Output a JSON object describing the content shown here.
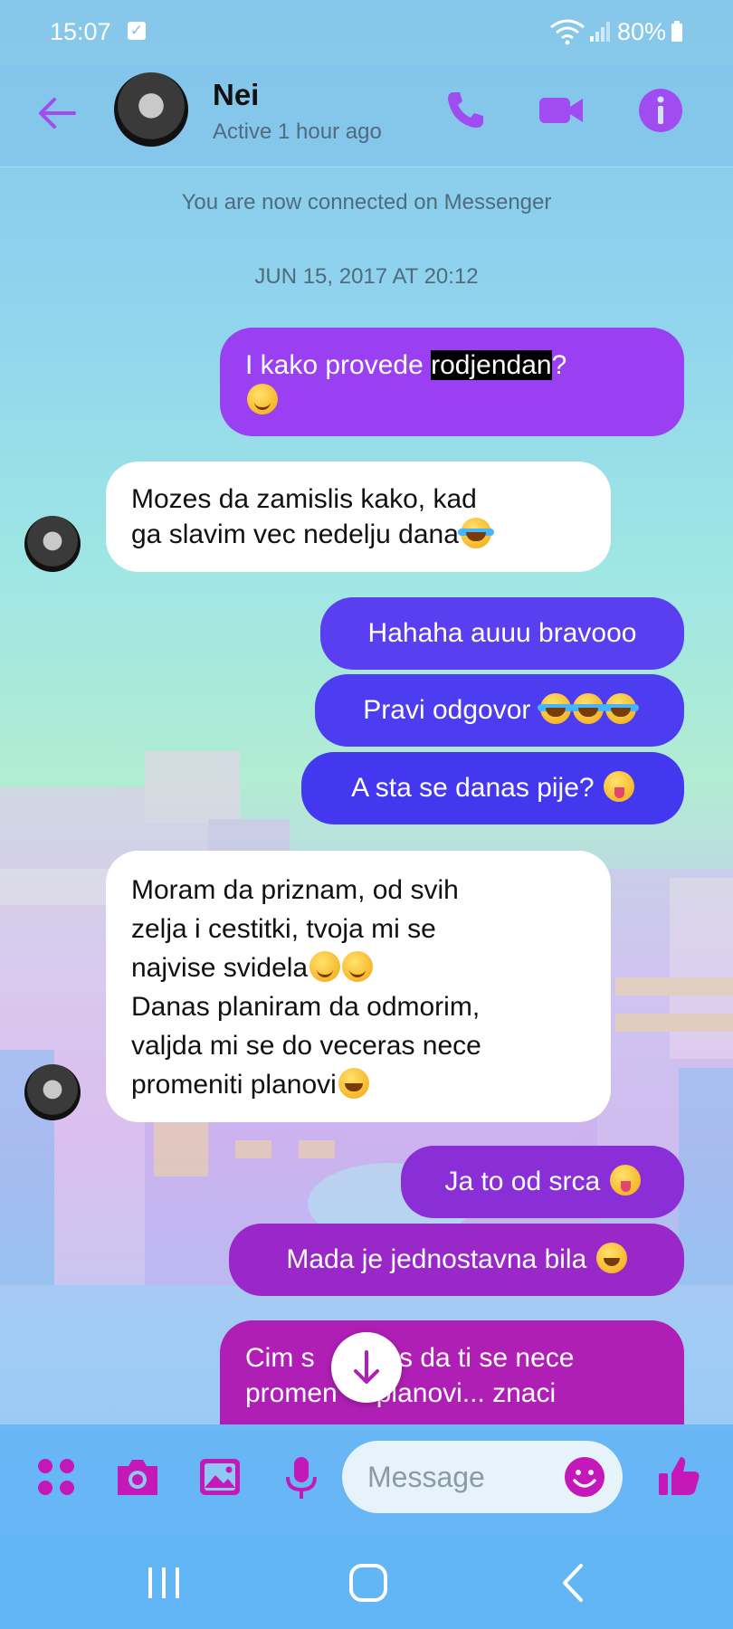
{
  "status_bar": {
    "time": "15:07",
    "battery": "80%"
  },
  "header": {
    "name": "Nei",
    "status": "Active 1 hour ago"
  },
  "chat": {
    "system_notice": "You are now connected on Messenger",
    "timestamp": "JUN 15, 2017 AT 20:12",
    "messages": [
      {
        "from": "me",
        "pre": "I kako provede ",
        "highlight": "rodjendan",
        "post": "?"
      },
      {
        "from": "them",
        "line1": "Mozes da zamislis kako, kad",
        "line2": "ga slavim vec nedelju dana"
      },
      {
        "from": "me",
        "text": "Hahaha auuu bravooo"
      },
      {
        "from": "me",
        "text": "Pravi odgovor"
      },
      {
        "from": "me",
        "text": "A sta se danas pije?"
      },
      {
        "from": "them",
        "lines": [
          "Moram da priznam, od svih",
          "zelja i cestitki, tvoja mi se",
          "najvise svidela",
          "Danas planiram da odmorim,",
          "valjda mi se do veceras nece",
          "promeniti planovi"
        ]
      },
      {
        "from": "me",
        "text": "Ja to od srca"
      },
      {
        "from": "me",
        "text": "Mada je jednostavna bila"
      },
      {
        "from": "me",
        "line1a": "Cim s",
        "line1b": "las da ti se nece",
        "line2a": "promen",
        "line2b": "i planovi... znaci"
      }
    ]
  },
  "composer": {
    "placeholder": "Message"
  },
  "colors": {
    "accent": "#a14cf0",
    "bubble_blue": "#4a3cf0",
    "bubble_violet": "#8a2fd8",
    "bubble_magenta": "#b01fb5"
  }
}
